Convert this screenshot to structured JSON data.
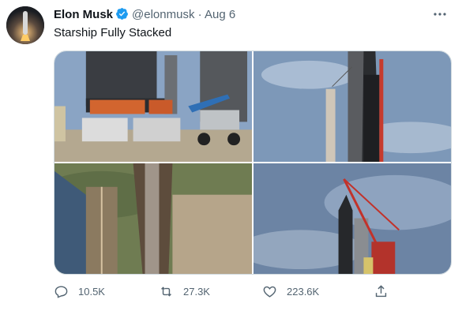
{
  "author": {
    "name": "Elon Musk",
    "handle": "@elonmusk",
    "separator": "·",
    "time": "Aug 6"
  },
  "tweet": {
    "text": "Starship Fully Stacked"
  },
  "media": {
    "photos": [
      {
        "icon": "rocket-base-photo"
      },
      {
        "icon": "stacked-starship-photo"
      },
      {
        "icon": "aerial-launch-tower-photo"
      },
      {
        "icon": "crane-starship-photo"
      }
    ]
  },
  "actions": {
    "replies": "10.5K",
    "retweets": "27.3K",
    "likes": "223.6K"
  },
  "colors": {
    "verified": "#1d9bf0",
    "muted": "#536471",
    "border": "#cfd9de"
  }
}
